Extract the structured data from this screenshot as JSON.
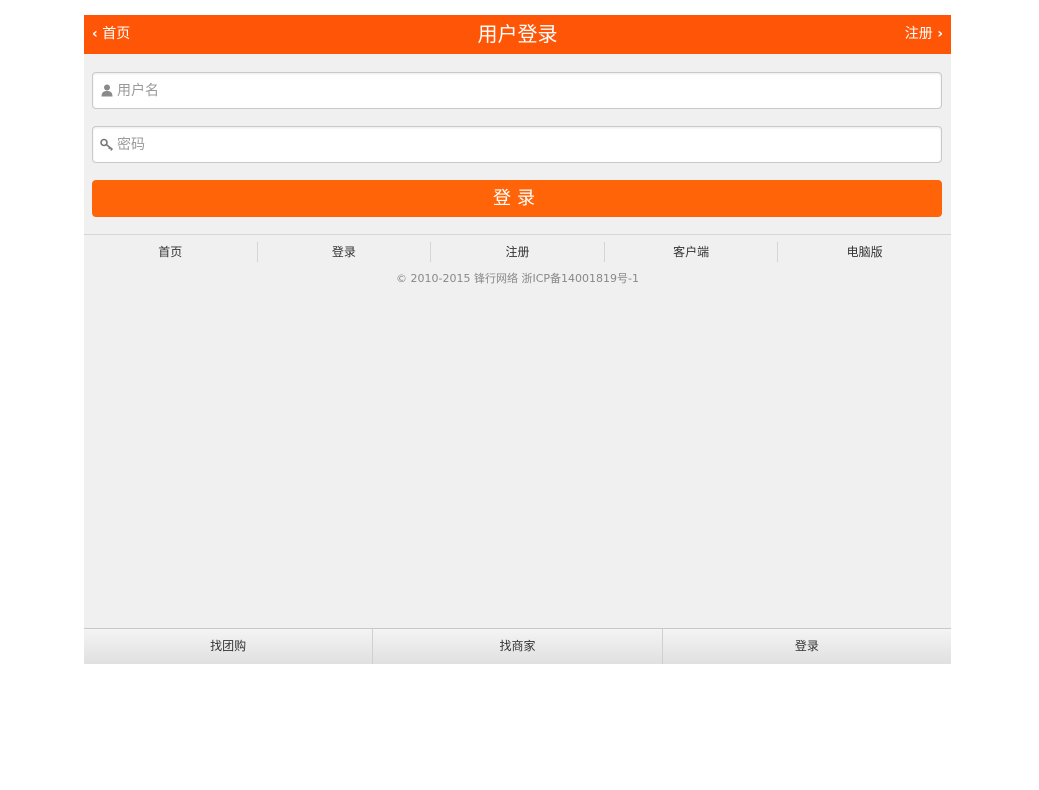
{
  "header": {
    "back_label": "首页",
    "title": "用户登录",
    "register_label": "注册"
  },
  "form": {
    "username_placeholder": "用户名",
    "password_placeholder": "密码",
    "username_icon": "user-icon",
    "password_icon": "key-icon",
    "submit_label": "登录"
  },
  "footer_nav": [
    {
      "label": "首页"
    },
    {
      "label": "登录"
    },
    {
      "label": "注册"
    },
    {
      "label": "客户端"
    },
    {
      "label": "电脑版"
    }
  ],
  "copyright": "© 2010-2015 锋行网络 浙ICP备14001819号-1",
  "tabbar": [
    {
      "label": "找团购"
    },
    {
      "label": "找商家"
    },
    {
      "label": "登录"
    }
  ],
  "colors": {
    "header": "#ff5506",
    "button": "#ff6409",
    "background": "#f0f0f0"
  }
}
